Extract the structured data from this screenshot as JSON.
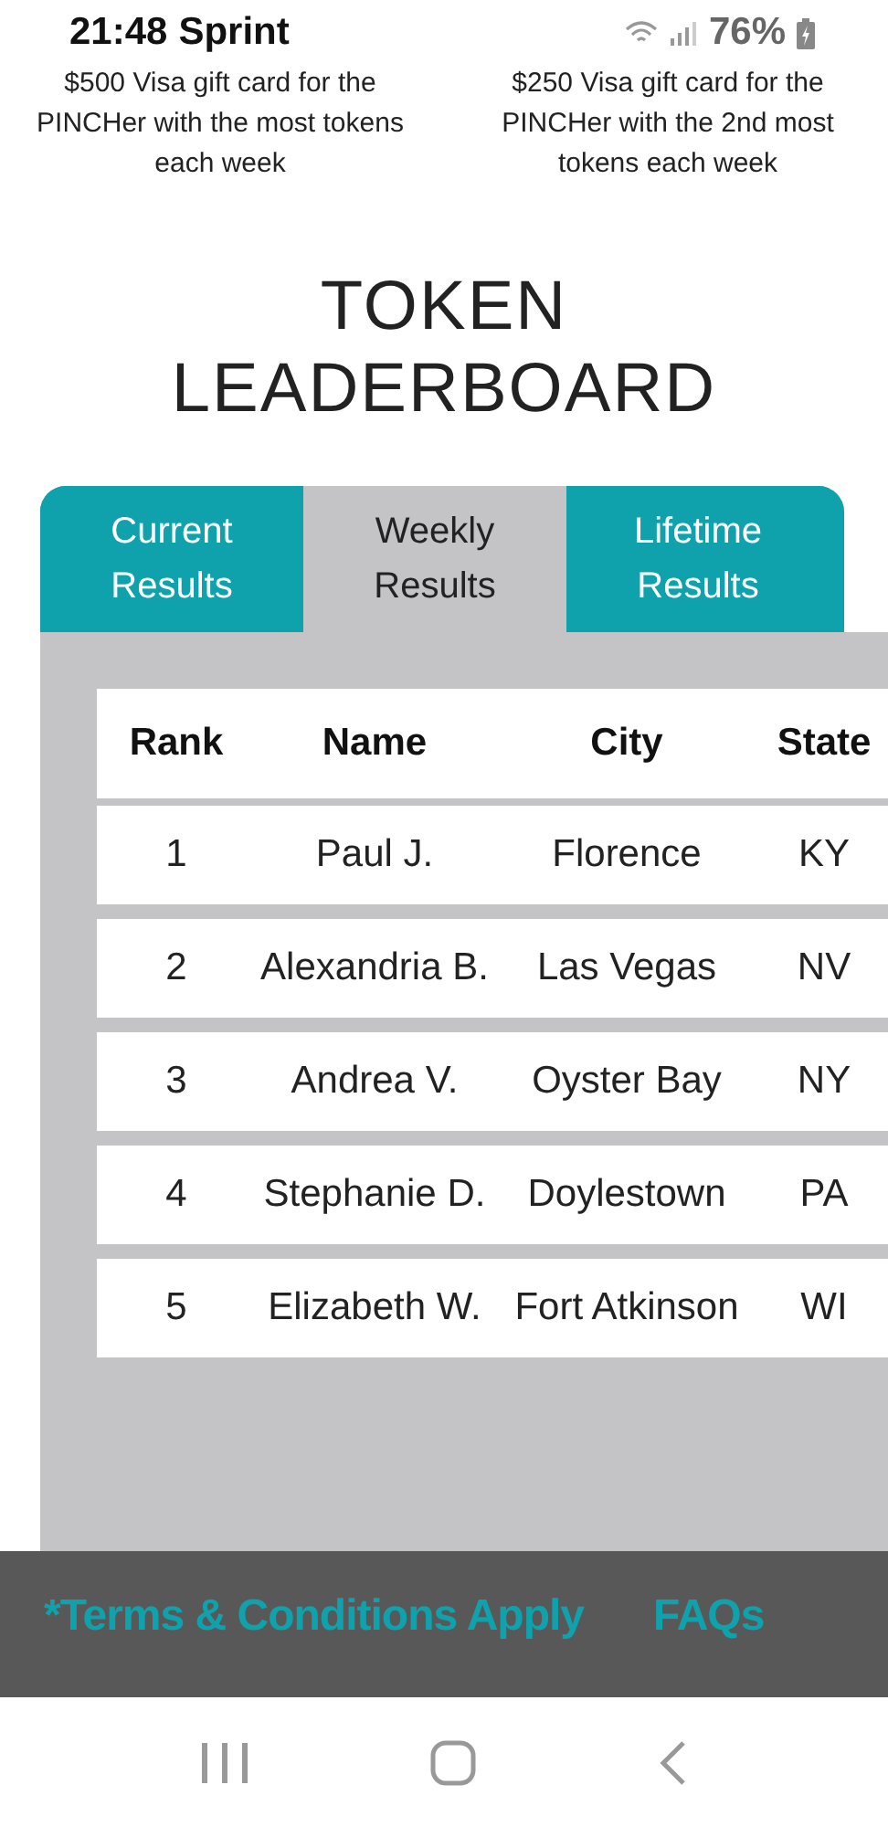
{
  "status_bar": {
    "time": "21:48",
    "carrier": "Sprint",
    "battery": "76%"
  },
  "prizes": [
    "$500 Visa gift card for the PINCHer with the most tokens each week",
    "$250 Visa gift card for the PINCHer with the 2nd most tokens each week"
  ],
  "title": "TOKEN LEADERBOARD",
  "tabs": [
    {
      "label": "Current Results",
      "selected": false
    },
    {
      "label": "Weekly Results",
      "selected": true
    },
    {
      "label": "Lifetime Results",
      "selected": false
    }
  ],
  "table": {
    "columns": [
      "Rank",
      "Name",
      "City",
      "State"
    ],
    "rows": [
      [
        "1",
        "Paul J.",
        "Florence",
        "KY"
      ],
      [
        "2",
        "Alexandria B.",
        "Las Vegas",
        "NV"
      ],
      [
        "3",
        "Andrea V.",
        "Oyster Bay",
        "NY"
      ],
      [
        "4",
        "Stephanie D.",
        "Doylestown",
        "PA"
      ],
      [
        "5",
        "Elizabeth W.",
        "Fort Atkinson",
        "WI"
      ]
    ]
  },
  "footer": {
    "links": [
      "*Terms & Conditions Apply",
      "FAQs"
    ]
  }
}
